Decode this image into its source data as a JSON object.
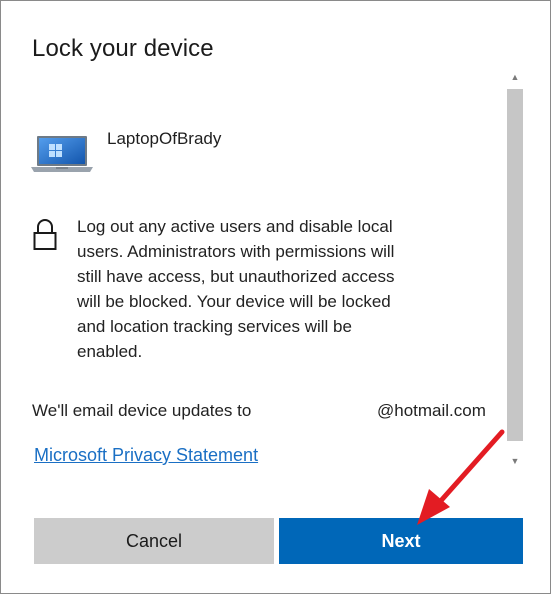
{
  "dialog": {
    "title": "Lock your device",
    "device": {
      "name": "LaptopOfBrady",
      "icon": "laptop-icon"
    },
    "lock_notice": {
      "icon": "lock-icon",
      "text": "Log out any active users and disable local users. Administrators with permissions will still have access, but unauthorized access will be blocked. Your device will be locked and location tracking services will be enabled."
    },
    "email": {
      "label": "We'll email device updates to",
      "domain": "@hotmail.com"
    },
    "privacy_link": "Microsoft Privacy Statement",
    "buttons": {
      "cancel": "Cancel",
      "next": "Next"
    }
  },
  "colors": {
    "primary": "#0067b8",
    "secondary_button": "#cccccc",
    "link": "#1a6fc4",
    "annotation_arrow": "#e31c23"
  }
}
